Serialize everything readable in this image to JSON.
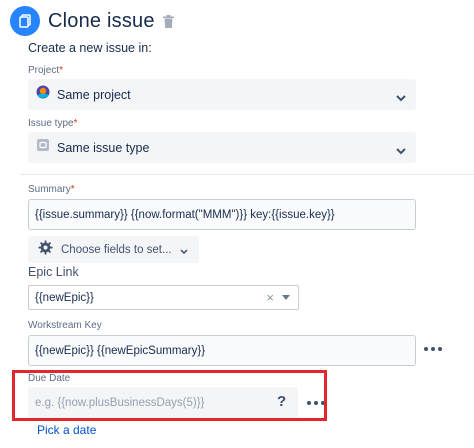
{
  "header": {
    "title": "Clone issue",
    "icon": "clone-icon",
    "delete_icon": "trash-icon",
    "accent": "#2684ff"
  },
  "subtitle": "Create a new issue in:",
  "project": {
    "label": "Project",
    "required_mark": "*",
    "value": "Same project",
    "icon": "project-avatar-icon"
  },
  "issue_type": {
    "label": "Issue type",
    "required_mark": "*",
    "value": "Same issue type",
    "icon": "issue-type-icon"
  },
  "summary": {
    "label": "Summary",
    "required_mark": "*",
    "value": "{{issue.summary}} {{now.format(\"MMM\")}} key:{{issue.key}}"
  },
  "choose_fields": {
    "label": "Choose fields to set...",
    "icon": "gear-icon"
  },
  "epic_link": {
    "label": "Epic Link",
    "value": "{{newEpic}}",
    "clear": "×"
  },
  "workstream_key": {
    "label": "Workstream Key",
    "value": "{{newEpic}} {{newEpicSummary}}"
  },
  "due_date": {
    "label": "Due Date",
    "placeholder": "e.g. {{now.plusBusinessDays(5)}}",
    "help": "?",
    "highlight_color": "#e3262b"
  },
  "pick_date": "Pick a date"
}
